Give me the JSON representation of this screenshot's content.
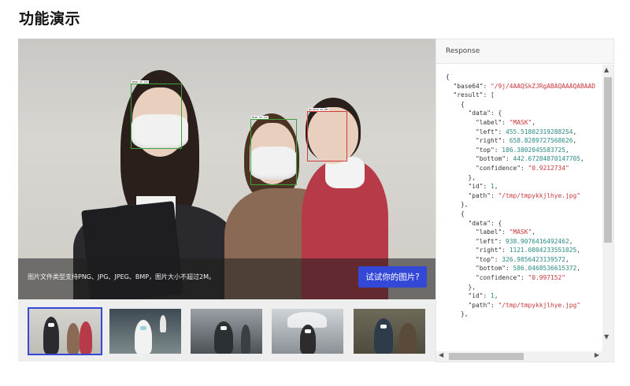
{
  "page": {
    "title": "功能演示"
  },
  "demo": {
    "hint": "图片文件类型支持PNG、JPG、JPEG、BMP，图片大小不超过2M。",
    "try_button": "试试你的图片?",
    "detections": [
      {
        "tag": "MASK 92.12%"
      },
      {
        "tag": "MASK 99.71%"
      },
      {
        "tag": "NO_MASK 99.08%"
      }
    ]
  },
  "response": {
    "title": "Response",
    "lines": [
      {
        "t": [
          [
            "p",
            "{"
          ]
        ]
      },
      {
        "t": [
          [
            "p",
            "  \"base64\": "
          ],
          [
            "s",
            "\"/9j/4AAQSkZJRgABAQAAAQABAAD"
          ]
        ]
      },
      {
        "t": [
          [
            "p",
            "  \"result\": ["
          ]
        ]
      },
      {
        "t": [
          [
            "p",
            "    {"
          ]
        ]
      },
      {
        "t": [
          [
            "p",
            "      \"data\": {"
          ]
        ]
      },
      {
        "t": [
          [
            "p",
            "        \"label\": "
          ],
          [
            "s",
            "\"MASK\""
          ],
          [
            "p",
            ","
          ]
        ]
      },
      {
        "t": [
          [
            "p",
            "        \"left\": "
          ],
          [
            "n",
            "455.51802319288254"
          ],
          [
            "p",
            ","
          ]
        ]
      },
      {
        "t": [
          [
            "p",
            "        \"right\": "
          ],
          [
            "n",
            "658.8289727568626"
          ],
          [
            "p",
            ","
          ]
        ]
      },
      {
        "t": [
          [
            "p",
            "        \"top\": "
          ],
          [
            "n",
            "186.3802045583725"
          ],
          [
            "p",
            ","
          ]
        ]
      },
      {
        "t": [
          [
            "p",
            "        \"bottom\": "
          ],
          [
            "n",
            "442.67284870147705"
          ],
          [
            "p",
            ","
          ]
        ]
      },
      {
        "t": [
          [
            "p",
            "        \"confidence\": "
          ],
          [
            "s",
            "\"0.9212734\""
          ]
        ]
      },
      {
        "t": [
          [
            "p",
            "      },"
          ]
        ]
      },
      {
        "t": [
          [
            "p",
            "      \"id\": "
          ],
          [
            "n",
            "1"
          ],
          [
            "p",
            ","
          ]
        ]
      },
      {
        "t": [
          [
            "p",
            "      \"path\": "
          ],
          [
            "s",
            "\"/tmp/tmpykkjlhye.jpg\""
          ]
        ]
      },
      {
        "t": [
          [
            "p",
            "    },"
          ]
        ]
      },
      {
        "t": [
          [
            "p",
            "    {"
          ]
        ]
      },
      {
        "t": [
          [
            "p",
            "      \"data\": {"
          ]
        ]
      },
      {
        "t": [
          [
            "p",
            "        \"label\": "
          ],
          [
            "s",
            "\"MASK\""
          ],
          [
            "p",
            ","
          ]
        ]
      },
      {
        "t": [
          [
            "p",
            "        \"left\": "
          ],
          [
            "n",
            "938.9076416492462"
          ],
          [
            "p",
            ","
          ]
        ]
      },
      {
        "t": [
          [
            "p",
            "        \"right\": "
          ],
          [
            "n",
            "1121.0804233551025"
          ],
          [
            "p",
            ","
          ]
        ]
      },
      {
        "t": [
          [
            "p",
            "        \"top\": "
          ],
          [
            "n",
            "326.9856423139572"
          ],
          [
            "p",
            ","
          ]
        ]
      },
      {
        "t": [
          [
            "p",
            "        \"bottom\": "
          ],
          [
            "n",
            "586.0468536615372"
          ],
          [
            "p",
            ","
          ]
        ]
      },
      {
        "t": [
          [
            "p",
            "        \"confidence\": "
          ],
          [
            "s",
            "\"0.997152\""
          ]
        ]
      },
      {
        "t": [
          [
            "p",
            "      },"
          ]
        ]
      },
      {
        "t": [
          [
            "p",
            "      \"id\": "
          ],
          [
            "n",
            "1"
          ],
          [
            "p",
            ","
          ]
        ]
      },
      {
        "t": [
          [
            "p",
            "      \"path\": "
          ],
          [
            "s",
            "\"/tmp/tmpykkjlhye.jpg\""
          ]
        ]
      },
      {
        "t": [
          [
            "p",
            "    },"
          ]
        ]
      }
    ]
  },
  "colors": {
    "accent": "#3348d6",
    "string": "#c6383b",
    "number": "#2a8a86",
    "box_ok": "#3da13d",
    "box_bad": "#d23b3b"
  },
  "icons": {
    "scroll_up": "chevron-up-icon",
    "scroll_down": "chevron-down-icon",
    "scroll_left": "chevron-left-icon",
    "scroll_right": "chevron-right-icon"
  }
}
